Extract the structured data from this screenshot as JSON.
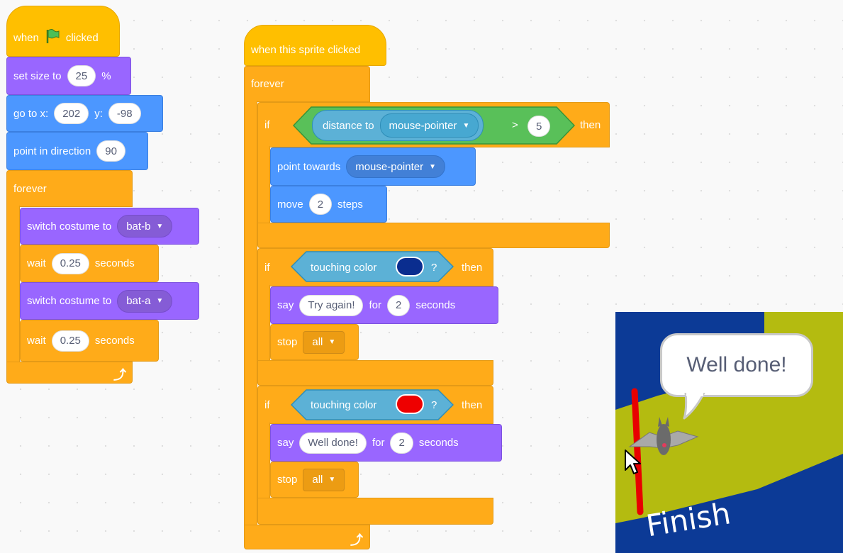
{
  "script1": {
    "when_label": "when",
    "clicked_label": "clicked",
    "set_size_label": "set size to",
    "size_value": "25",
    "percent_label": "%",
    "goto_label": "go to x:",
    "x_value": "202",
    "y_label": "y:",
    "y_value": "-98",
    "point_dir_label": "point in direction",
    "dir_value": "90",
    "forever_label": "forever",
    "switch_costume_label": "switch costume to",
    "costume_b": "bat-b",
    "wait_label": "wait",
    "wait_value_1": "0.25",
    "seconds_label": "seconds",
    "costume_a": "bat-a",
    "wait_value_2": "0.25"
  },
  "script2": {
    "hat_label": "when this sprite clicked",
    "forever_label": "forever",
    "if_label": "if",
    "then_label": "then",
    "distance_label": "distance to",
    "distance_target": "mouse-pointer",
    "gt_label": ">",
    "gt_value": "5",
    "point_towards_label": "point towards",
    "point_target": "mouse-pointer",
    "move_label": "move",
    "move_value": "2",
    "steps_label": "steps",
    "touching_color_label": "touching color",
    "question_mark": "?",
    "say_label": "say",
    "say_text_1": "Try again!",
    "for_label": "for",
    "say_secs_1": "2",
    "seconds_label": "seconds",
    "stop_label": "stop",
    "stop_option_1": "all",
    "say_text_2": "Well done!",
    "say_secs_2": "2",
    "stop_option_2": "all"
  },
  "stage": {
    "speech_text": "Well done!",
    "finish_label": "Finish"
  },
  "colors": {
    "touching_color_1": "#0a2d8f",
    "touching_color_2": "#ee0000",
    "stage_blue": "#0c3a96",
    "stage_green": "#b4bb10",
    "finish_line": "#e80000"
  }
}
